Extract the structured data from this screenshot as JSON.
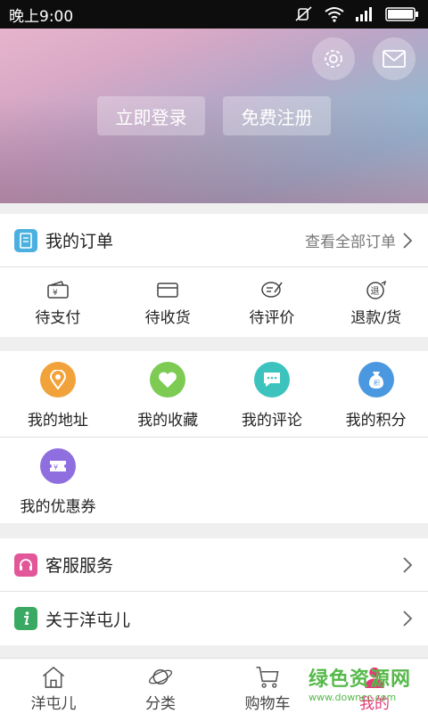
{
  "status_bar": {
    "time": "晚上9:00"
  },
  "header": {
    "login_label": "立即登录",
    "register_label": "免费注册",
    "icons": {
      "settings": "gear-icon",
      "mail": "mail-icon"
    }
  },
  "orders": {
    "title": "我的订单",
    "view_all": "查看全部订单",
    "statuses": [
      {
        "label": "待支付",
        "icon": "wallet-icon"
      },
      {
        "label": "待收货",
        "icon": "card-icon"
      },
      {
        "label": "待评价",
        "icon": "review-icon"
      },
      {
        "label": "退款/货",
        "icon": "refund-icon"
      }
    ]
  },
  "features": [
    {
      "label": "我的地址",
      "icon": "location-icon",
      "color": "#f2a23a"
    },
    {
      "label": "我的收藏",
      "icon": "heart-icon",
      "color": "#7ecb54"
    },
    {
      "label": "我的评论",
      "icon": "comment-icon",
      "color": "#3cc3bd"
    },
    {
      "label": "我的积分",
      "icon": "points-bag-icon",
      "color": "#4a98e0"
    },
    {
      "label": "我的优惠券",
      "icon": "coupon-icon",
      "color": "#8f6fe0"
    }
  ],
  "service": {
    "label": "客服服务",
    "icon": "headset-icon",
    "color": "#e2579a"
  },
  "about": {
    "label": "关于洋屯儿",
    "icon": "info-icon",
    "color": "#3aa963"
  },
  "tabs": [
    {
      "label": "洋屯儿",
      "icon": "home-icon"
    },
    {
      "label": "分类",
      "icon": "planet-icon"
    },
    {
      "label": "购物车",
      "icon": "cart-icon"
    },
    {
      "label": "我的",
      "icon": "user-icon",
      "active": true
    }
  ],
  "watermark": {
    "text": "绿色资源网",
    "url": "www.downcc.com"
  },
  "colors": {
    "accent": "#e23c78",
    "background": "#efefef"
  }
}
